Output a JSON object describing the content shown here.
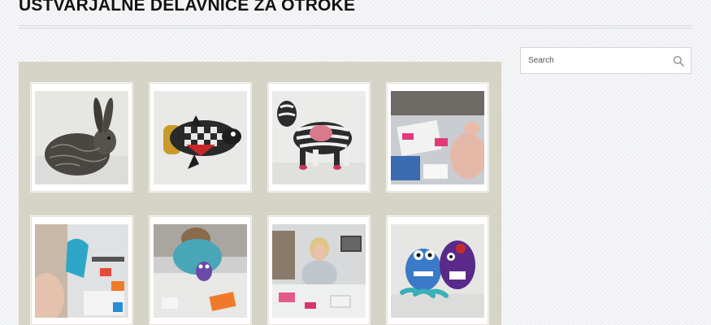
{
  "page": {
    "title": "USTVARJALNE DELAVNICE ZA OTROKE"
  },
  "search": {
    "placeholder": "Search",
    "icon": "search-icon"
  },
  "gallery": {
    "items": [
      {
        "subject": "Paper-mache rabbit"
      },
      {
        "subject": "Paper-mache penguin"
      },
      {
        "subject": "Paper-mache zebra"
      },
      {
        "subject": "Children crafting at table"
      },
      {
        "subject": "Child sewing blue fabric"
      },
      {
        "subject": "Child with purple toy"
      },
      {
        "subject": "Girl working at workshop table"
      },
      {
        "subject": "Two felt monster toys"
      }
    ]
  }
}
